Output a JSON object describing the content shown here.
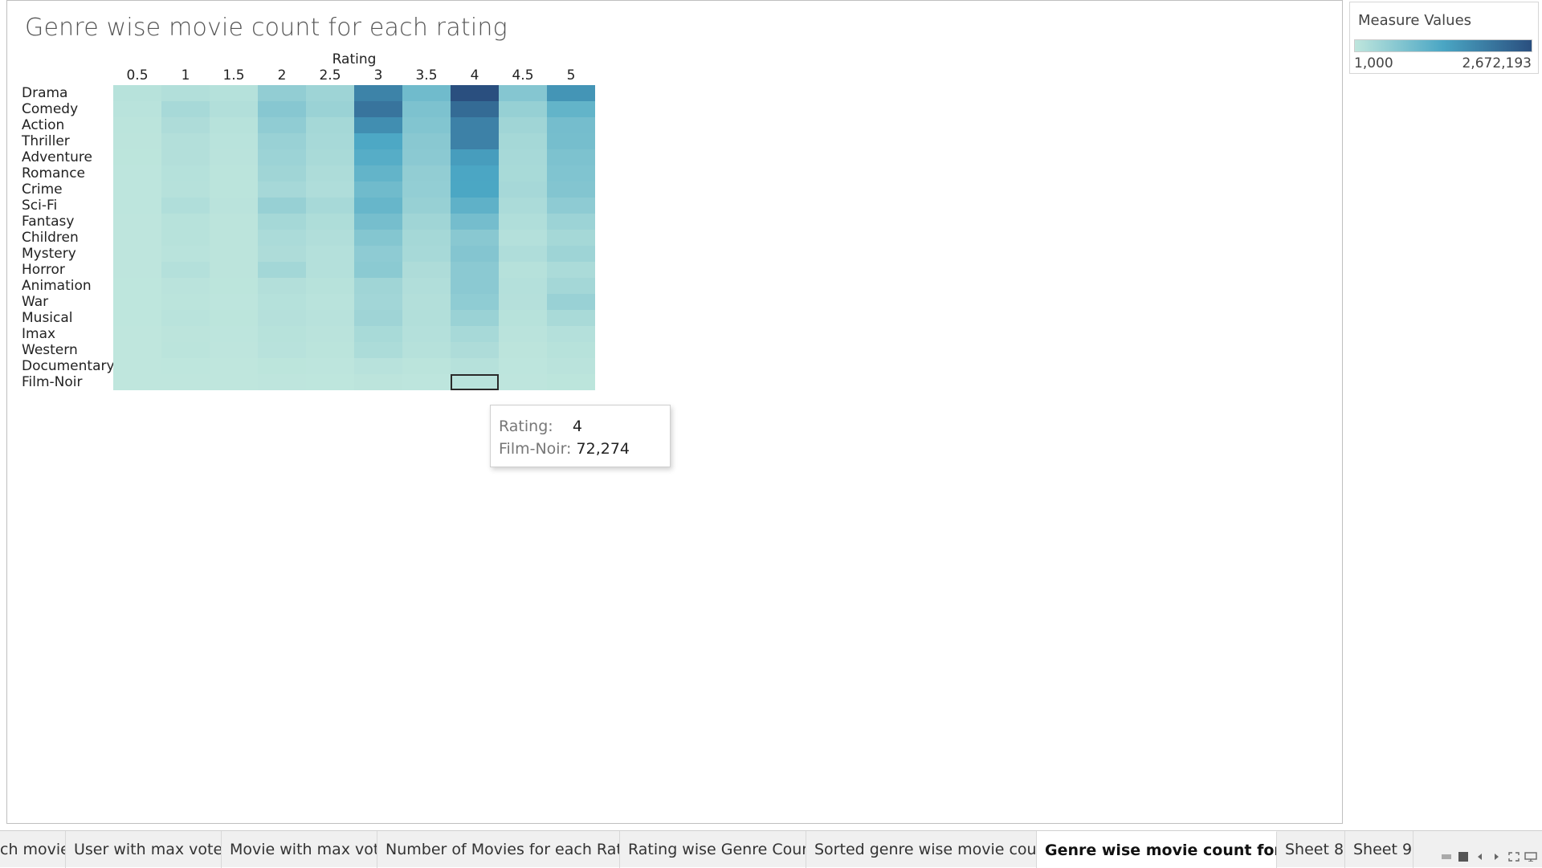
{
  "sheet": {
    "title": "Genre wise movie count for each rating"
  },
  "legend": {
    "title": "Measure Values",
    "min_label": "1,000",
    "max_label": "2,672,193",
    "min_value": 1000,
    "max_value": 2672193,
    "colors": [
      "#bfe6dd",
      "#4aa6c4",
      "#2a4f7f"
    ]
  },
  "chart_data": {
    "type": "heatmap",
    "title": "Genre wise movie count for each rating",
    "column_axis_title": "Rating",
    "columns": [
      "0.5",
      "1",
      "1.5",
      "2",
      "2.5",
      "3",
      "3.5",
      "4",
      "4.5",
      "5"
    ],
    "rows": [
      "Drama",
      "Comedy",
      "Action",
      "Thriller",
      "Adventure",
      "Romance",
      "Crime",
      "Sci-Fi",
      "Fantasy",
      "Children",
      "Mystery",
      "Horror",
      "Animation",
      "War",
      "Musical",
      "Imax",
      "Western",
      "Documentary",
      "Film-Noir"
    ],
    "values": [
      [
        90000,
        150000,
        110000,
        520000,
        380000,
        1880000,
        900000,
        2672193,
        660000,
        1600000
      ],
      [
        70000,
        280000,
        150000,
        640000,
        420000,
        2100000,
        760000,
        2250000,
        470000,
        1050000
      ],
      [
        50000,
        200000,
        90000,
        540000,
        300000,
        1700000,
        700000,
        1900000,
        350000,
        850000
      ],
      [
        40000,
        140000,
        70000,
        440000,
        270000,
        1300000,
        620000,
        1900000,
        300000,
        840000
      ],
      [
        30000,
        140000,
        60000,
        400000,
        250000,
        1200000,
        600000,
        1480000,
        280000,
        750000
      ],
      [
        25000,
        110000,
        50000,
        350000,
        210000,
        1050000,
        520000,
        1330000,
        260000,
        720000
      ],
      [
        22000,
        100000,
        45000,
        290000,
        180000,
        900000,
        500000,
        1320000,
        290000,
        690000
      ],
      [
        25000,
        170000,
        60000,
        460000,
        280000,
        1000000,
        460000,
        1100000,
        230000,
        560000
      ],
      [
        18000,
        90000,
        40000,
        300000,
        190000,
        840000,
        350000,
        850000,
        170000,
        400000
      ],
      [
        14000,
        90000,
        40000,
        230000,
        160000,
        670000,
        300000,
        620000,
        130000,
        300000
      ],
      [
        12000,
        70000,
        35000,
        200000,
        130000,
        560000,
        270000,
        680000,
        180000,
        380000
      ],
      [
        15000,
        130000,
        40000,
        320000,
        130000,
        590000,
        200000,
        600000,
        100000,
        230000
      ],
      [
        10000,
        60000,
        30000,
        140000,
        90000,
        360000,
        160000,
        600000,
        130000,
        310000
      ],
      [
        8000,
        50000,
        25000,
        110000,
        70000,
        330000,
        140000,
        550000,
        120000,
        440000
      ],
      [
        9000,
        70000,
        30000,
        120000,
        80000,
        370000,
        150000,
        420000,
        90000,
        250000
      ],
      [
        5000,
        40000,
        20000,
        90000,
        60000,
        260000,
        130000,
        280000,
        60000,
        130000
      ],
      [
        5000,
        50000,
        15000,
        80000,
        50000,
        220000,
        100000,
        200000,
        40000,
        90000
      ],
      [
        2000,
        10000,
        5000,
        30000,
        20000,
        80000,
        50000,
        100000,
        20000,
        60000
      ],
      [
        1000,
        5000,
        2000,
        12000,
        8000,
        40000,
        25000,
        72274,
        12000,
        30000
      ]
    ],
    "selected": {
      "row": "Film-Noir",
      "column": "4"
    }
  },
  "tooltip": {
    "rating_label": "Rating:",
    "rating_value": "4",
    "genre_label": "Film-Noir:",
    "genre_value": "72,274"
  },
  "tabs": [
    {
      "label": "ch movie",
      "active": false
    },
    {
      "label": "User with max votes",
      "active": false
    },
    {
      "label": "Movie with max votes",
      "active": false
    },
    {
      "label": "Number of Movies for each Rating",
      "active": false
    },
    {
      "label": "Rating wise Genre Count",
      "active": false
    },
    {
      "label": "Sorted genre wise movie count",
      "active": false
    },
    {
      "label": "Genre wise movie count for ea...",
      "active": true
    },
    {
      "label": "Sheet 8",
      "active": false
    },
    {
      "label": "Sheet 9",
      "active": false
    }
  ],
  "tab_controls": {
    "filmstrip_icon": "filmstrip-icon",
    "grid_icon": "grid-icon",
    "prev_icon": "prev-icon",
    "next_icon": "next-icon",
    "fullscreen_icon": "fullscreen-icon",
    "present_icon": "present-icon"
  }
}
